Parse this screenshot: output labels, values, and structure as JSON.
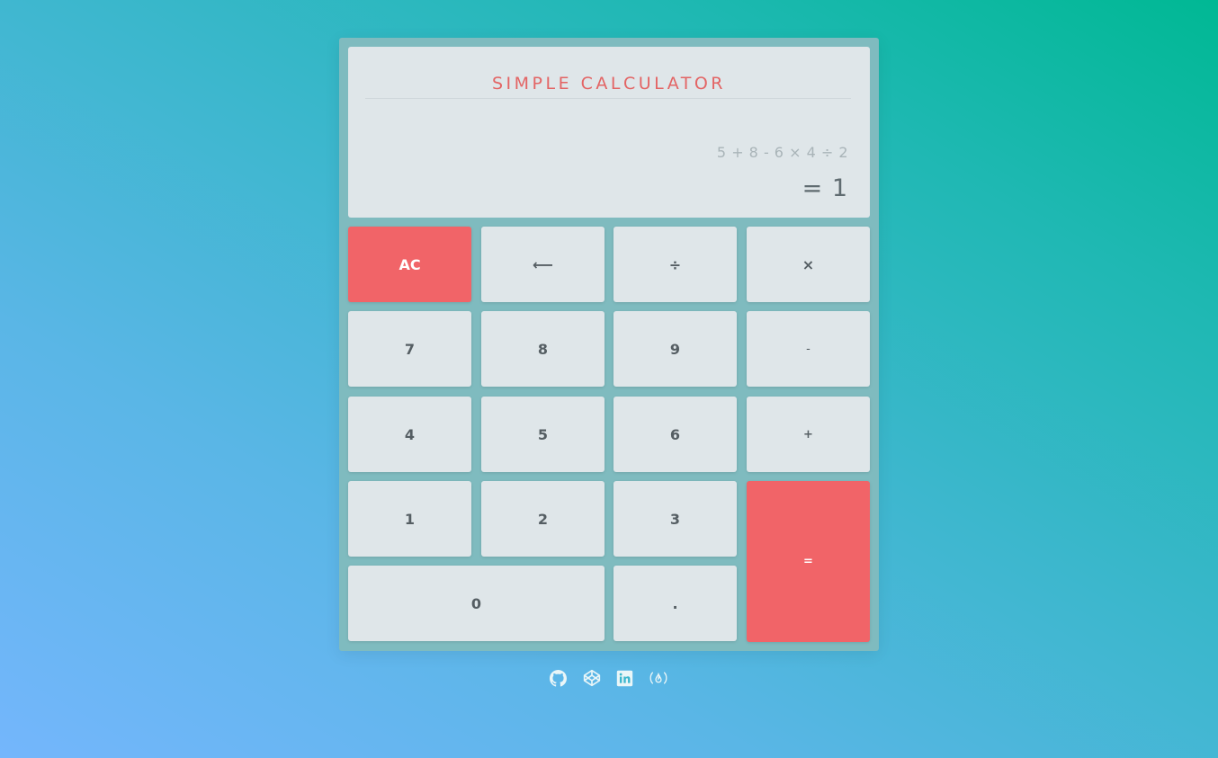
{
  "calculator": {
    "title": "SIMPLE CALCULATOR",
    "expression": "5 + 8 - 6 × 4 ÷ 2",
    "result": "= 1"
  },
  "keys": {
    "clear": "AC",
    "backspace": "⟵",
    "divide": "÷",
    "multiply": "×",
    "seven": "7",
    "eight": "8",
    "nine": "9",
    "subtract": "-",
    "four": "4",
    "five": "5",
    "six": "6",
    "add": "+",
    "one": "1",
    "two": "2",
    "three": "3",
    "equals": "=",
    "zero": "0",
    "decimal": "."
  },
  "footer": {
    "icons": [
      "github-icon",
      "codepen-icon",
      "linkedin-icon",
      "freecodecamp-icon"
    ]
  },
  "colors": {
    "accent": "#f16468",
    "title": "#e36464",
    "screen_bg": "#dfe6e9",
    "frame_bg": "#7fbbbf"
  }
}
